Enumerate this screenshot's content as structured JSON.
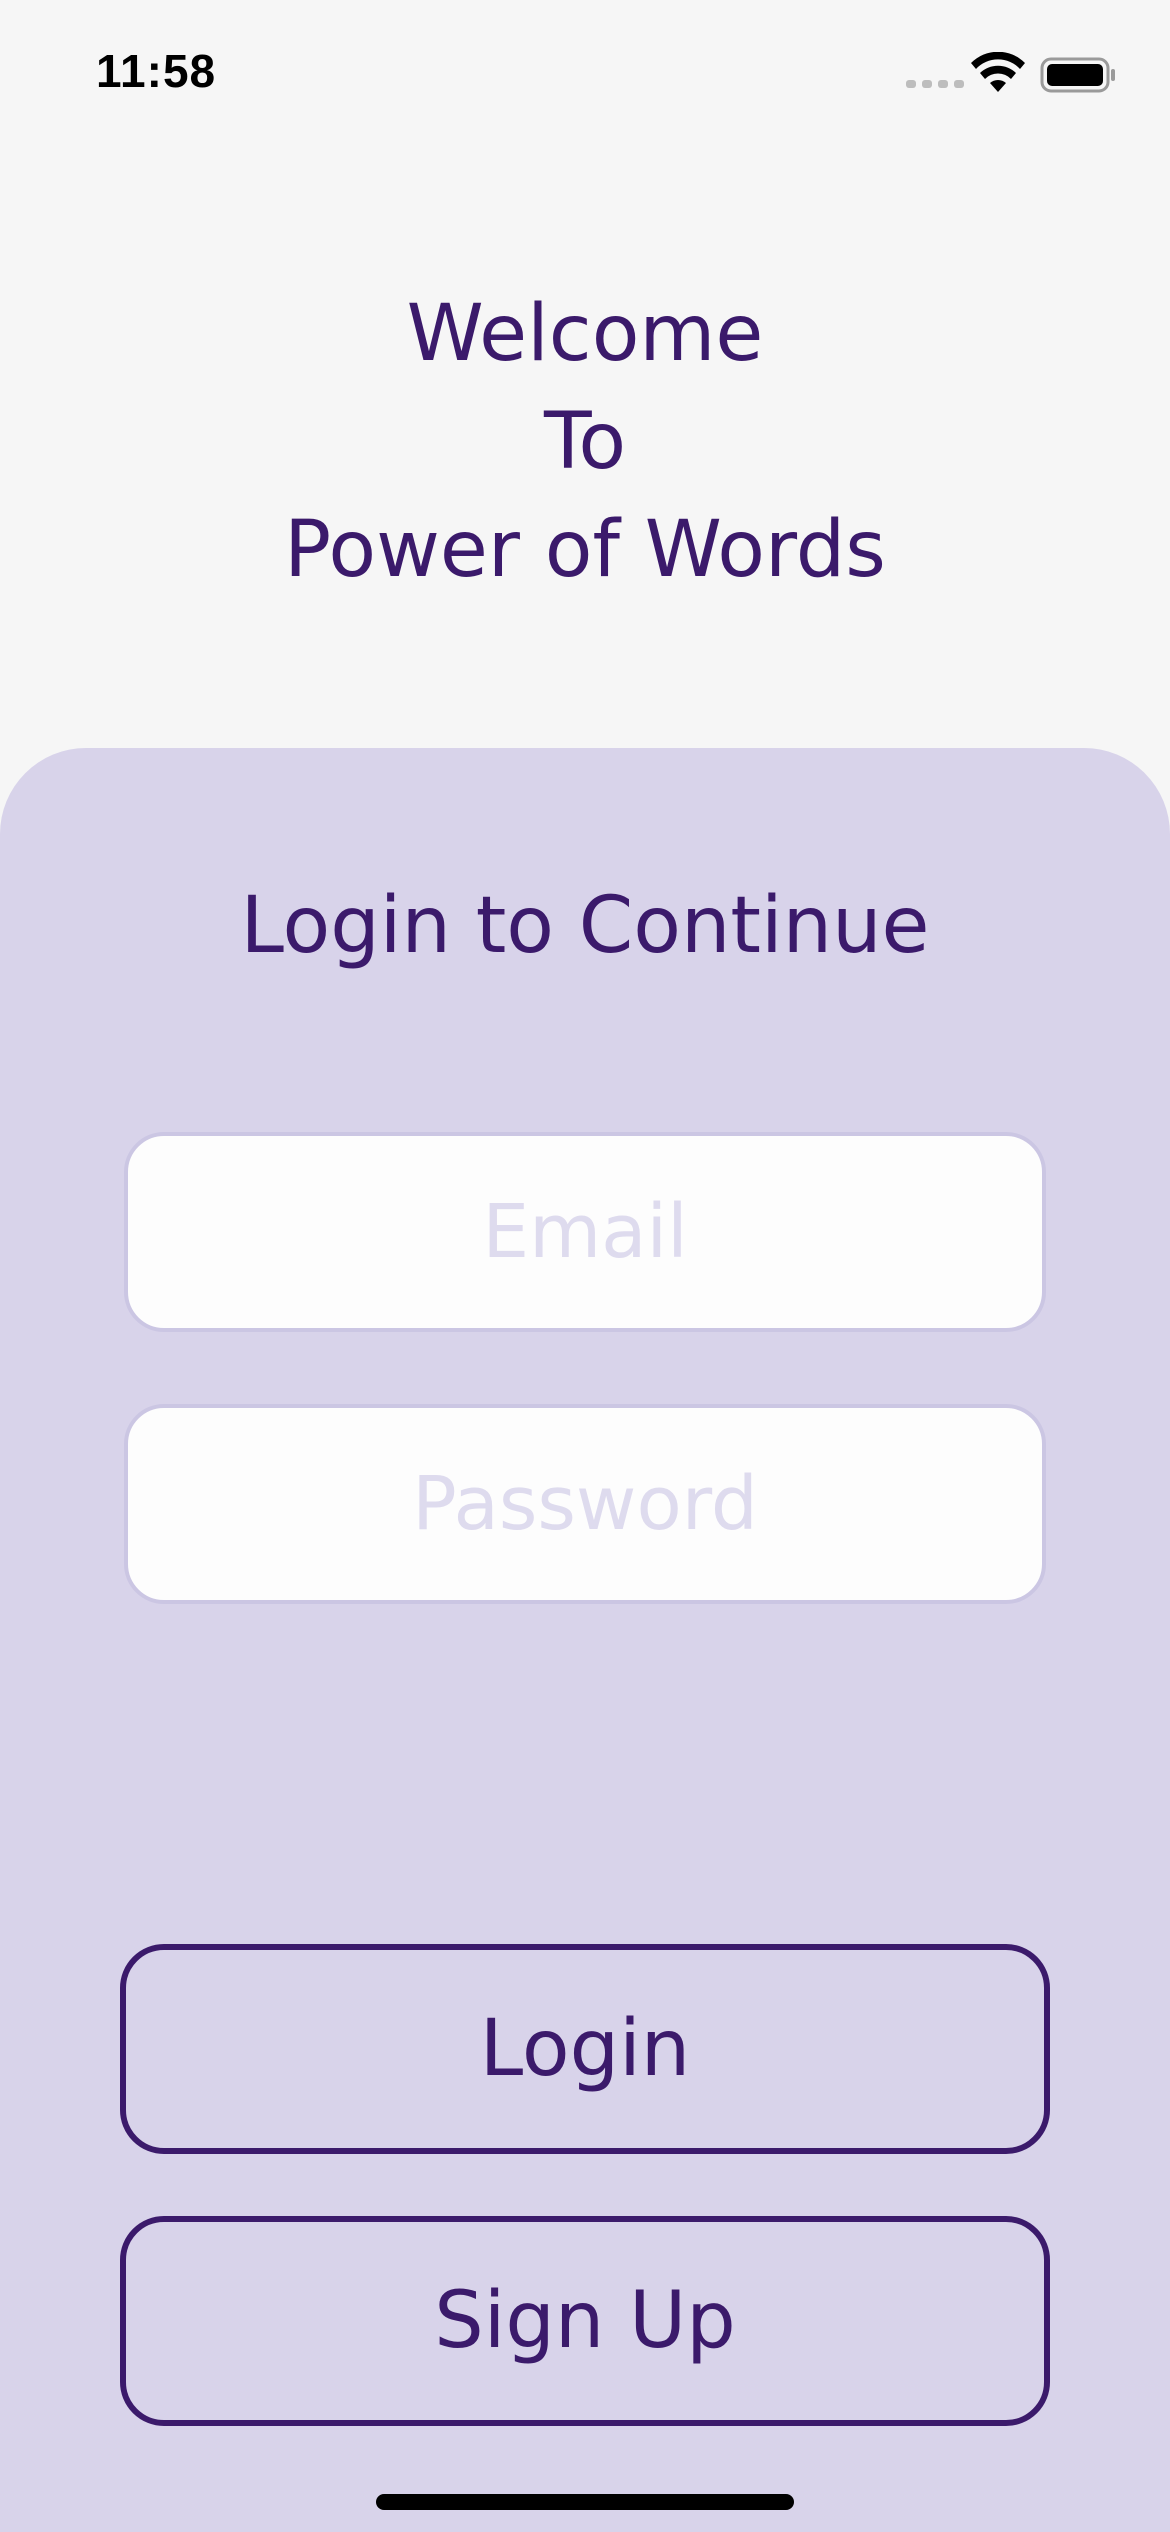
{
  "status_bar": {
    "time": "11:58",
    "icons": [
      "signal-icon",
      "wifi-icon",
      "battery-icon"
    ]
  },
  "welcome": {
    "line1": "Welcome",
    "line2": "To",
    "line3": "Power of Words"
  },
  "login_panel": {
    "title": "Login to Continue",
    "email_placeholder": "Email",
    "password_placeholder": "Password",
    "login_label": "Login",
    "signup_label": "Sign Up"
  },
  "colors": {
    "accent": "#3b1a6b",
    "panel_background": "#d8d3ea",
    "page_background": "#f6f6f6",
    "placeholder": "#dedbee"
  }
}
